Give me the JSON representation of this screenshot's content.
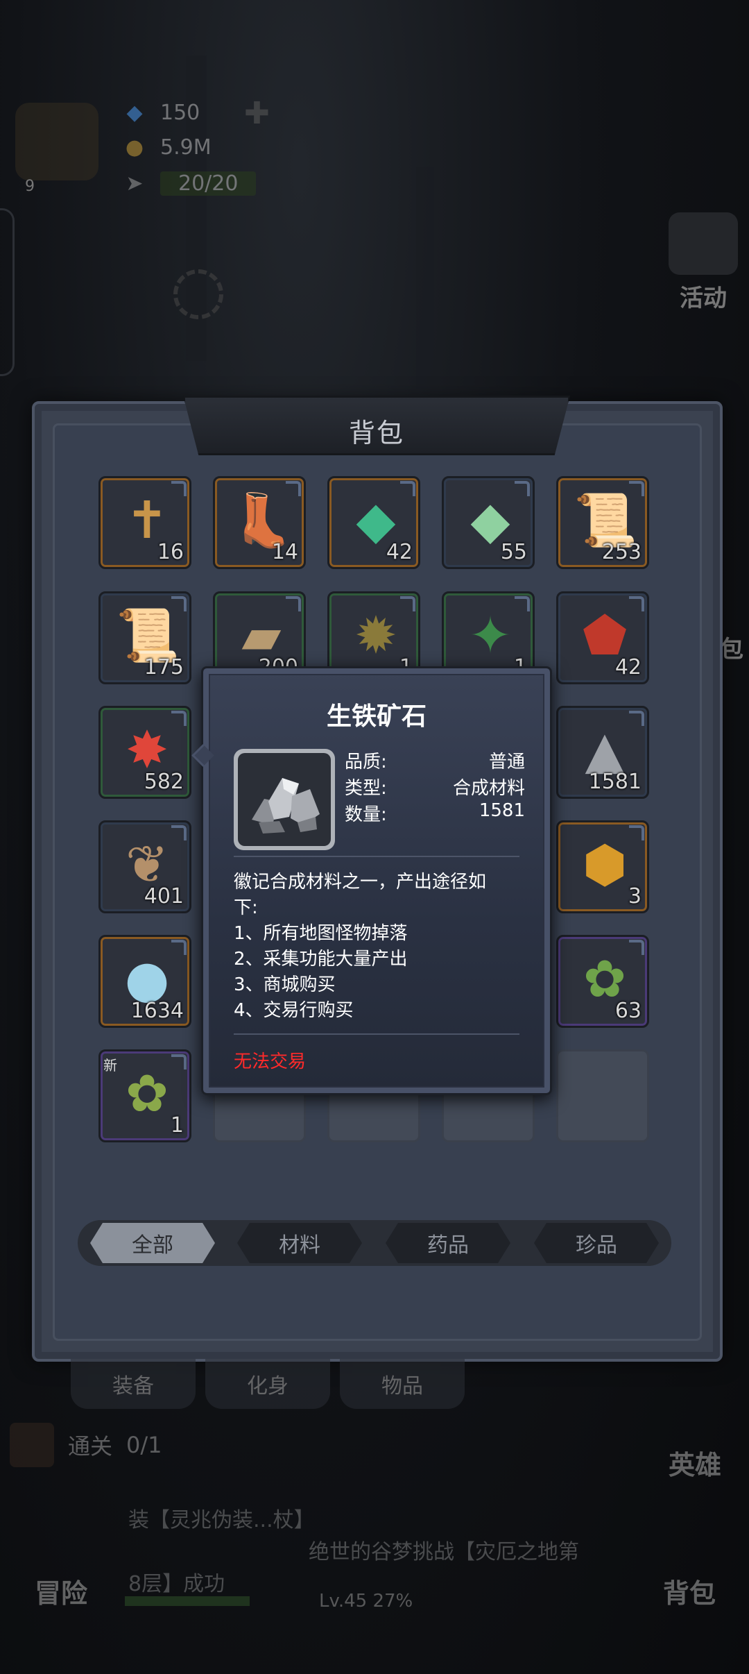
{
  "player": {
    "level": "9",
    "gems": "150",
    "gold": "5.9M",
    "stamina": "20/20"
  },
  "right_menu": {
    "activity": "活动",
    "backpack_side": "包",
    "hero": "英雄",
    "backpack": "背包"
  },
  "panel": {
    "title": "背包"
  },
  "items": [
    {
      "count": "16",
      "icon": "cross-icon"
    },
    {
      "count": "14",
      "icon": "winged-boot-icon"
    },
    {
      "count": "42",
      "icon": "gem-book-icon"
    },
    {
      "count": "55",
      "icon": "green-crystal-icon"
    },
    {
      "count": "253",
      "icon": "scroll-icon"
    },
    {
      "count": "175",
      "icon": "sword-scroll-icon"
    },
    {
      "count": "200",
      "icon": "paper-icon"
    },
    {
      "count": "1",
      "icon": "rune-compass-icon"
    },
    {
      "count": "1",
      "icon": "green-rune-icon"
    },
    {
      "count": "42",
      "icon": "red-shield-icon"
    },
    {
      "count": "582",
      "icon": "ruby-emblem-icon"
    },
    {
      "count": "1581",
      "icon": "iron-ore-icon"
    },
    {
      "count": "401",
      "icon": "feather-icon"
    },
    {
      "count": "3",
      "icon": "golden-shield-icon"
    },
    {
      "count": "1634",
      "icon": "blue-orb-icon"
    },
    {
      "count": "63",
      "icon": "green-herb-icon"
    },
    {
      "count": "1",
      "icon": "herb-branch-icon",
      "badge": "新"
    }
  ],
  "tabs": [
    "全部",
    "材料",
    "药品",
    "珍品"
  ],
  "sub_tabs": [
    "装备",
    "化身",
    "物品"
  ],
  "quest": {
    "prefix": "通关",
    "suffix": "0/1"
  },
  "log": {
    "line1": "装【灵兆伪装...杖】",
    "line2": "绝世的谷梦挑战【灾厄之地第",
    "line3": "8层】成功"
  },
  "nav": {
    "adventure": "冒险"
  },
  "exp": {
    "text": "Lv.45   27%",
    "percent": 27
  },
  "tooltip": {
    "name": "生铁矿石",
    "quality_label": "品质:",
    "quality_value": "普通",
    "type_label": "类型:",
    "type_value": "合成材料",
    "qty_label": "数量:",
    "qty_value": "1581",
    "desc_lines": [
      "徽记合成材料之一，产出途径如",
      "下:",
      "1、所有地图怪物掉落",
      "2、采集功能大量产出",
      "3、商城购买",
      "4、交易行购买"
    ],
    "trade": "无法交易",
    "icon": "iron-ore-icon"
  },
  "colors": {
    "accent_red": "#ff2a2a",
    "panel_bg": "#3b4250",
    "tooltip_bg": "#2a3142"
  }
}
